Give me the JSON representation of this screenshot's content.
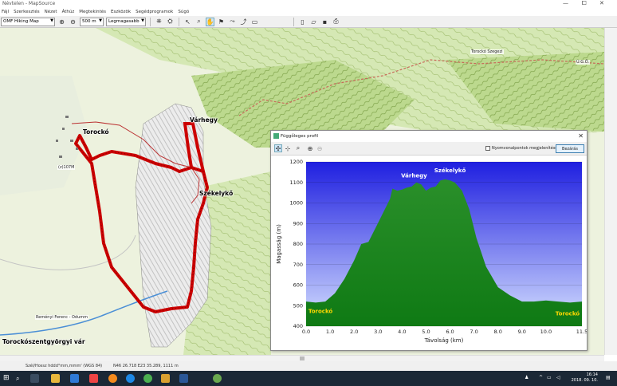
{
  "window": {
    "title": "Névtelen - MapSource",
    "buttons": [
      "—",
      "⧠",
      "✕"
    ]
  },
  "menu": {
    "items": [
      "Fájl",
      "Szerkesztés",
      "Nézet",
      "Áthúz",
      "Megtekintés",
      "Eszközök",
      "Segédprogramok",
      "Súgó"
    ]
  },
  "toolbar": {
    "map_select": "OMF Hiking Map",
    "zoom_level": "500 m",
    "detail_level": "Legmagasabb"
  },
  "map": {
    "labels": {
      "torocko": "Torockó",
      "varhegy": "Várhegy",
      "szekelyko": "Székelykő",
      "torockoszentgyorgy": "Torockószentgyörgyi vár"
    },
    "small_labels": {
      "elev1": "(z)107M",
      "label_ne": "Torockó Szegezi",
      "label_e": "Ú.G.Ö.",
      "label_s": "Reményi Ferenc - Odumm"
    }
  },
  "status": {
    "grid": "Szél/Hossz hddd°mm,mmm' (WGS 84)",
    "coords": "N46 26.718 E23 35.289, 1111 m"
  },
  "taskbar": {
    "time": "16:14",
    "date": "2018. 09. 10."
  },
  "profile": {
    "title": "Függőleges profil",
    "checkbox_label": "Nyomvonalpontok megjelenítése",
    "close_label": "Bezárás"
  },
  "colors": {
    "sky_top": "#1f1fe0",
    "sky_bottom": "#d5e0ff",
    "fill_top": "#2a8f2a",
    "fill_bottom": "#0f7a14",
    "track": "#c80000",
    "map_bg": "#e6eed2"
  },
  "chart_data": {
    "type": "area",
    "title": "",
    "xlabel": "Távolság  (km)",
    "ylabel": "Magasság  (m)",
    "xlim": [
      0,
      11.5
    ],
    "ylim": [
      400,
      1200
    ],
    "xticks": [
      0.0,
      1.0,
      2.0,
      3.0,
      4.0,
      5.0,
      6.0,
      7.0,
      8.0,
      9.0,
      10.0,
      11.5
    ],
    "yticks": [
      400,
      500,
      600,
      700,
      800,
      900,
      1000,
      1100,
      1200
    ],
    "x": [
      0.0,
      0.4,
      0.8,
      1.2,
      1.6,
      2.0,
      2.3,
      2.6,
      2.9,
      3.2,
      3.5,
      3.6,
      3.8,
      4.0,
      4.2,
      4.4,
      4.6,
      4.8,
      5.0,
      5.2,
      5.4,
      5.6,
      5.8,
      6.0,
      6.2,
      6.5,
      6.8,
      7.1,
      7.5,
      8.0,
      8.5,
      9.0,
      9.5,
      10.0,
      10.5,
      11.0,
      11.5
    ],
    "y": [
      520,
      515,
      520,
      560,
      630,
      720,
      800,
      810,
      880,
      950,
      1020,
      1070,
      1060,
      1065,
      1075,
      1080,
      1100,
      1090,
      1060,
      1075,
      1080,
      1110,
      1115,
      1110,
      1100,
      1060,
      970,
      830,
      690,
      590,
      550,
      520,
      520,
      525,
      520,
      515,
      520
    ],
    "annotations": [
      {
        "text": "Várhegy",
        "x": 4.5,
        "y": 1125
      },
      {
        "text": "Székelykő",
        "x": 6.0,
        "y": 1150
      },
      {
        "text": "Torockó",
        "x": 0.6,
        "y": 465
      },
      {
        "text": "Torockó",
        "x": 10.9,
        "y": 452
      }
    ]
  }
}
